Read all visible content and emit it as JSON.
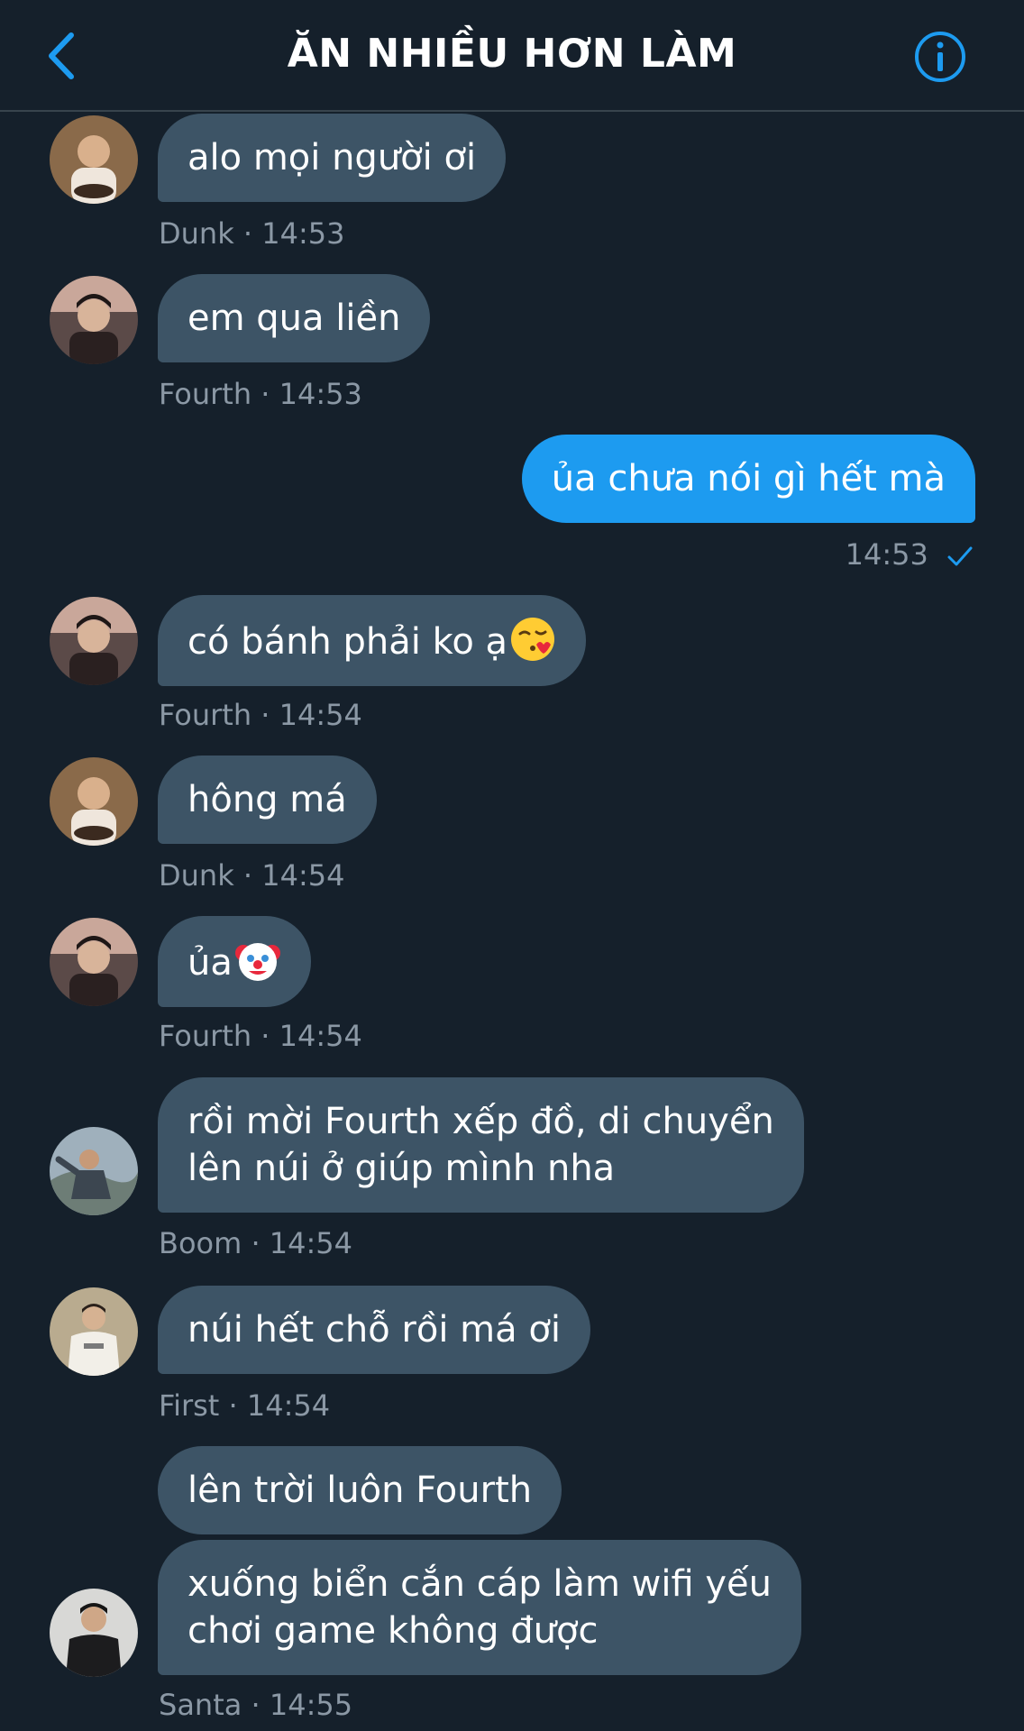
{
  "header": {
    "title": "ĂN NHIỀU HƠN LÀM",
    "back_icon": "chevron-left-icon",
    "info_icon": "info-icon",
    "accent_color": "#1d9bf0"
  },
  "colors": {
    "background": "#15202b",
    "incoming_bubble": "#3d5466",
    "outgoing_bubble": "#1d9bf0",
    "meta_text": "#8b98a5"
  },
  "messages": [
    {
      "text": "alo mọi người ơi",
      "sender": "Dunk",
      "time": "14:53",
      "meta": "Dunk · 14:53"
    },
    {
      "text": "em qua liền",
      "sender": "Fourth",
      "time": "14:53",
      "meta": "Fourth · 14:53"
    },
    {
      "text": "ủa chưa nói gì hết mà",
      "outgoing": true,
      "time": "14:53",
      "meta": "14:53",
      "status_icon": "check-icon"
    },
    {
      "text": "có bánh phải ko ạ",
      "emoji": "kissing-heart-emoji",
      "sender": "Fourth",
      "time": "14:54",
      "meta": "Fourth · 14:54"
    },
    {
      "text": "hông má",
      "sender": "Dunk",
      "time": "14:54",
      "meta": "Dunk · 14:54"
    },
    {
      "text": "ủa",
      "emoji": "clown-face-emoji",
      "sender": "Fourth",
      "time": "14:54",
      "meta": "Fourth · 14:54"
    },
    {
      "lines": [
        "rồi mời Fourth xếp đồ, di chuyển",
        "lên núi ở giúp mình nha"
      ],
      "sender": "Boom",
      "time": "14:54",
      "meta": "Boom · 14:54"
    },
    {
      "text": "núi hết chỗ rồi má ơi",
      "sender": "First",
      "time": "14:54",
      "meta": "First · 14:54"
    },
    {
      "text": "lên trời luôn Fourth",
      "sender": "Santa",
      "time": "14:55"
    },
    {
      "lines": [
        "xuống biển cắn cáp làm wifi yếu",
        "chơi game không được"
      ],
      "sender": "Santa",
      "time": "14:55",
      "meta": "Santa · 14:55"
    }
  ]
}
